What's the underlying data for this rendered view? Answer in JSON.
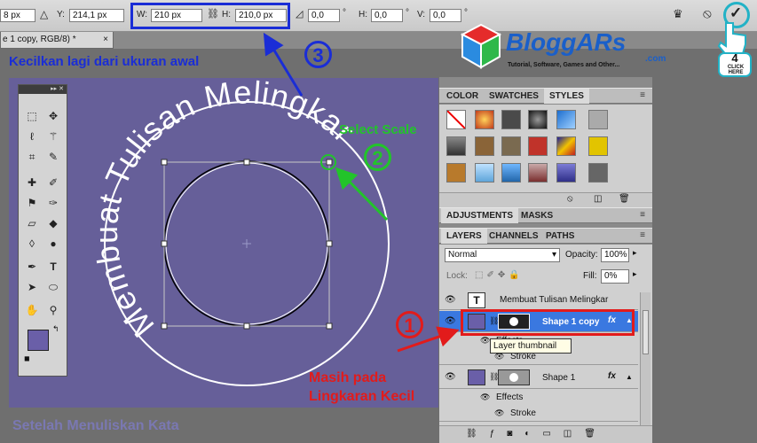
{
  "options_bar": {
    "x_value": "8 px",
    "y_label": "Y:",
    "y_value": "214,1 px",
    "w_label": "W:",
    "w_value": "210 px",
    "h_label": "H:",
    "h_value": "210,0 px",
    "angle_value": "0,0",
    "degree_symbol": "°",
    "hskew_label": "H:",
    "hskew_value": "0,0",
    "vskew_label": "V:",
    "vskew_value": "0,0",
    "degree_symbol2": "°",
    "degree_symbol3": "°",
    "cancel_icon": "cancel-transform-icon",
    "commit_icon": "commit-transform-icon"
  },
  "document_tab": {
    "title": "e 1 copy, RGB/8) *",
    "close": "×"
  },
  "canvas": {
    "curved_text": "Membuat Tulisan Melingkar",
    "background_color": "#665f99"
  },
  "tool_panel": {
    "header": "▸▸ ✕"
  },
  "panels": {
    "top_tabs": [
      "COLOR",
      "SWATCHES",
      "STYLES"
    ],
    "mid_tabs": [
      "ADJUSTMENTS",
      "MASKS"
    ],
    "layer_tabs": [
      "LAYERS",
      "CHANNELS",
      "PATHS"
    ],
    "menu_icon": "≡",
    "blend_mode": "Normal",
    "opacity_label": "Opacity:",
    "opacity_value": "100%",
    "lock_label": "Lock:",
    "fill_label": "Fill:",
    "fill_value": "0%",
    "layers": [
      {
        "name": "Membuat Tulisan Melingkar",
        "type": "T"
      },
      {
        "name": "Shape 1 copy",
        "fx": "fx",
        "selected": true
      },
      {
        "name": "Effects"
      },
      {
        "name": "Stroke"
      },
      {
        "name": "Shape 1",
        "fx": "fx"
      },
      {
        "name": "Effects"
      },
      {
        "name": "Stroke"
      }
    ]
  },
  "tooltip": "Layer thumbnail",
  "annotations": {
    "step1_number": "1",
    "step2_number": "2",
    "step3_number": "3",
    "step4_number": "4",
    "step1_text_line1": "Masih pada",
    "step1_text_line2": "Lingkaran Kecil",
    "step2_text": "Select Scale",
    "step3_text": "Kecilkan lagi dari ukuran awal",
    "click_here": "CLICK HERE",
    "footer": "Setelah Menuliskan Kata",
    "colors": {
      "red": "#e21b1b",
      "green": "#22c42a",
      "blue": "#1a2dd6",
      "cyan": "#22b2c6"
    }
  },
  "logo": {
    "name": "BloggARs",
    "domain": ".com",
    "tagline": "Tutorial, Software, Games and Other..."
  }
}
